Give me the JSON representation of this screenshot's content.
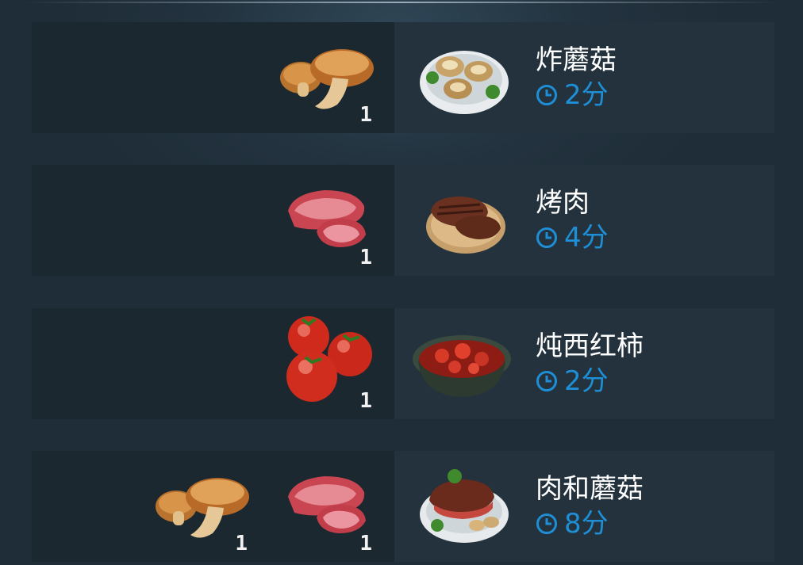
{
  "recipes": [
    {
      "name": "炸蘑菇",
      "time": "2分",
      "dish_icon": "fried-mushrooms-icon",
      "ingredients": [
        {
          "icon": "mushroom-icon",
          "qty": "1"
        }
      ]
    },
    {
      "name": "烤肉",
      "time": "4分",
      "dish_icon": "grilled-steak-icon",
      "ingredients": [
        {
          "icon": "raw-meat-icon",
          "qty": "1"
        }
      ]
    },
    {
      "name": "炖西红柿",
      "time": "2分",
      "dish_icon": "stewed-tomatoes-icon",
      "ingredients": [
        {
          "icon": "tomatoes-icon",
          "qty": "1"
        }
      ]
    },
    {
      "name": "肉和蘑菇",
      "time": "8分",
      "dish_icon": "steak-with-mushrooms-icon",
      "ingredients": [
        {
          "icon": "mushroom-icon",
          "qty": "1"
        },
        {
          "icon": "raw-meat-icon",
          "qty": "1"
        }
      ]
    }
  ],
  "colors": {
    "time_accent": "#1e8fd6",
    "panel_dark": "#1b282f",
    "panel": "#23323c"
  }
}
